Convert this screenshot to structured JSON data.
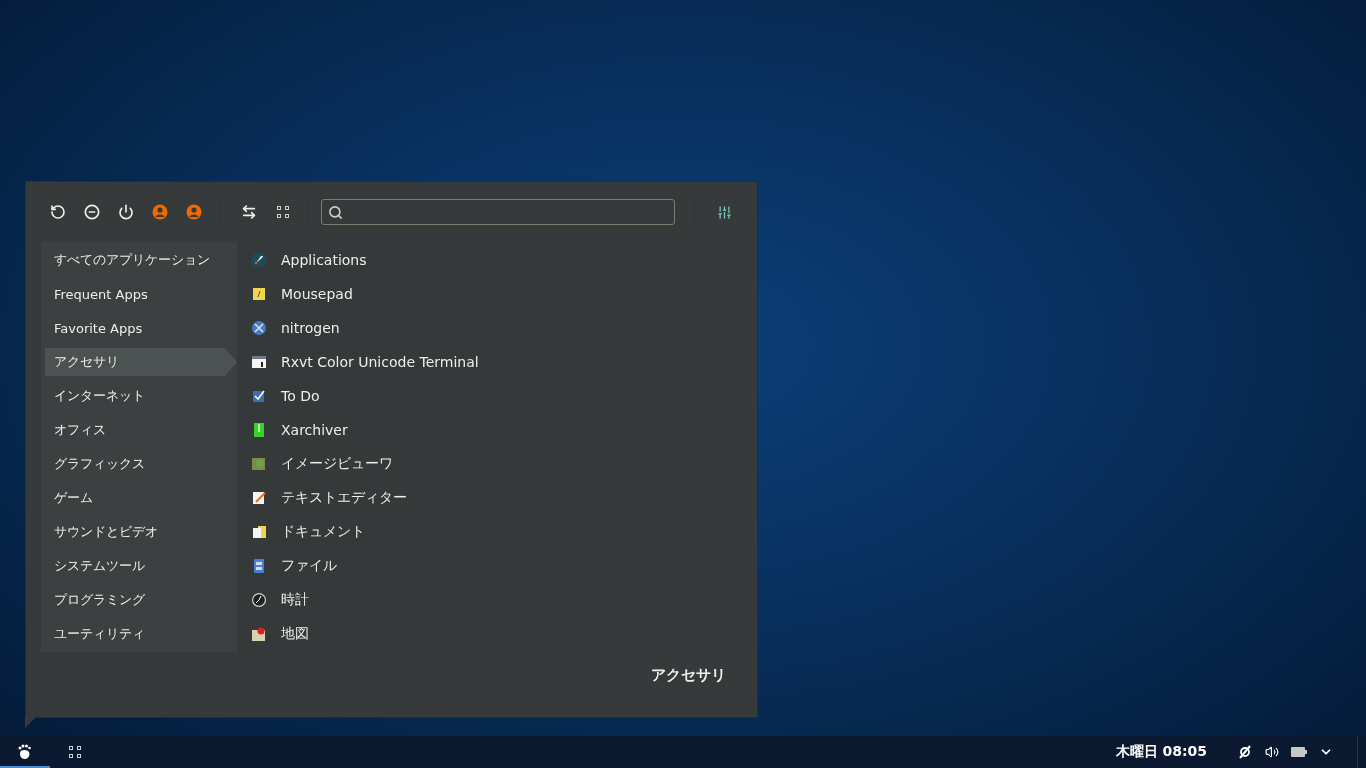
{
  "menu": {
    "categories": [
      {
        "label": "すべてのアプリケーション",
        "selected": false
      },
      {
        "label": "Frequent Apps",
        "selected": false
      },
      {
        "label": "Favorite Apps",
        "selected": false
      },
      {
        "label": "アクセサリ",
        "selected": true
      },
      {
        "label": "インターネット",
        "selected": false
      },
      {
        "label": "オフィス",
        "selected": false
      },
      {
        "label": "グラフィックス",
        "selected": false
      },
      {
        "label": "ゲーム",
        "selected": false
      },
      {
        "label": "サウンドとビデオ",
        "selected": false
      },
      {
        "label": "システムツール",
        "selected": false
      },
      {
        "label": "プログラミング",
        "selected": false
      },
      {
        "label": "ユーティリティ",
        "selected": false
      }
    ],
    "apps": [
      {
        "label": "Applications",
        "kind": "rocket"
      },
      {
        "label": "Mousepad",
        "kind": "notepad"
      },
      {
        "label": "nitrogen",
        "kind": "globe"
      },
      {
        "label": "Rxvt Color Unicode Terminal",
        "kind": "terminal"
      },
      {
        "label": "To Do",
        "kind": "checkbox"
      },
      {
        "label": "Xarchiver",
        "kind": "archive"
      },
      {
        "label": "イメージビューワ",
        "kind": "image"
      },
      {
        "label": "テキストエディター",
        "kind": "editor"
      },
      {
        "label": "ドキュメント",
        "kind": "document"
      },
      {
        "label": "ファイル",
        "kind": "cabinet"
      },
      {
        "label": "時計",
        "kind": "clock"
      },
      {
        "label": "地図",
        "kind": "map"
      }
    ],
    "footer": "アクセサリ"
  },
  "taskbar": {
    "launchers": [
      {
        "kind": "foot",
        "selected": true
      },
      {
        "kind": "grid",
        "selected": false
      }
    ],
    "clock": "木曜日 08:05"
  }
}
